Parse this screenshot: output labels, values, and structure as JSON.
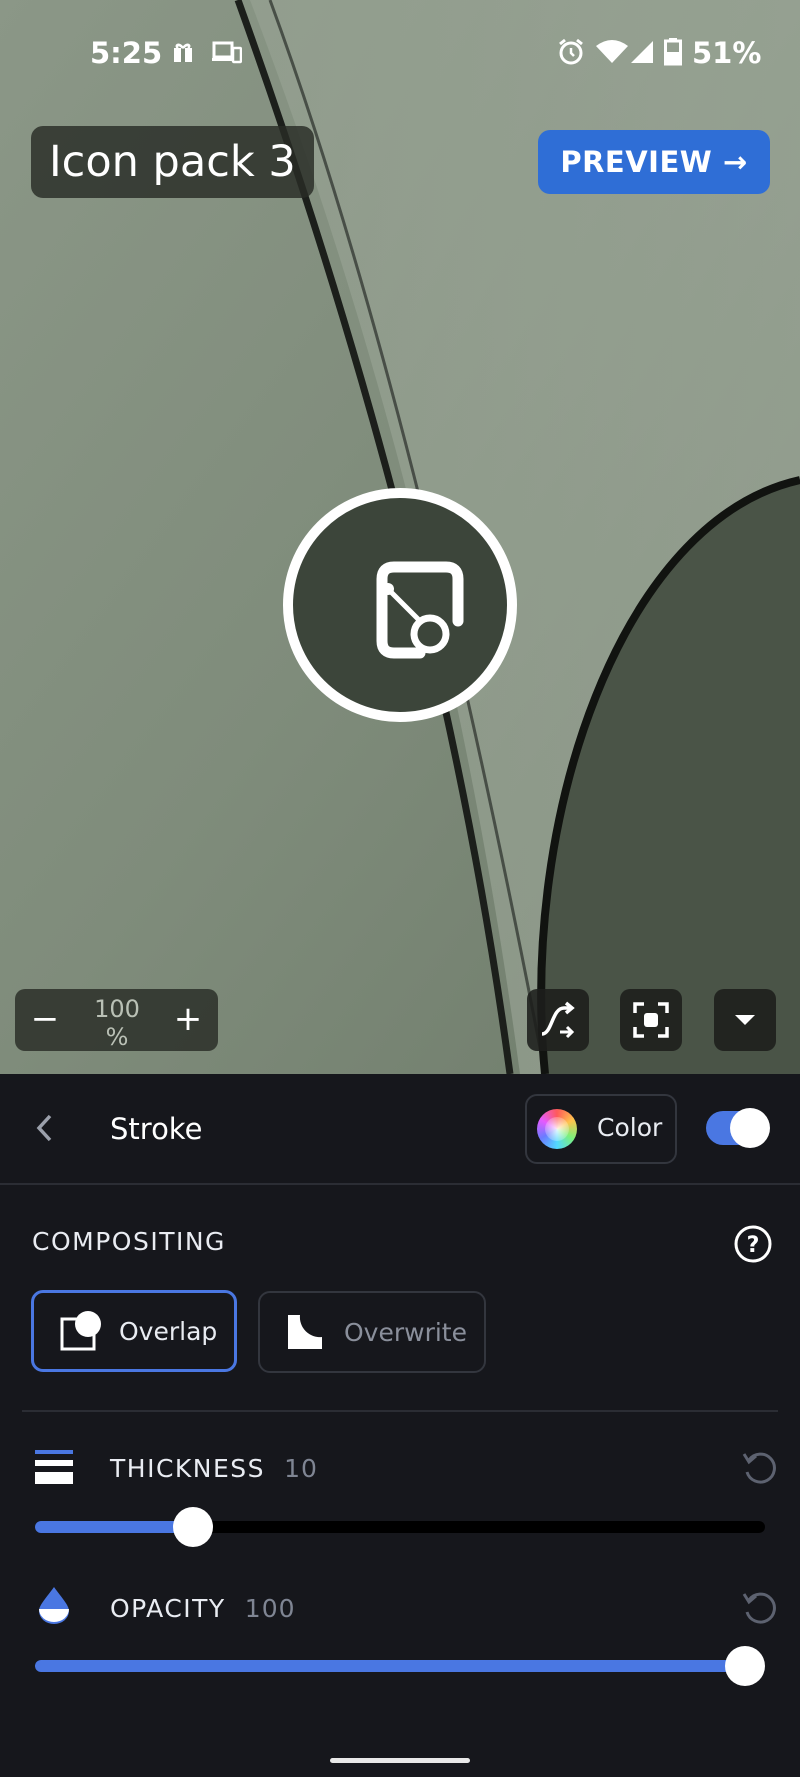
{
  "status": {
    "time": "5:25",
    "battery": "51%"
  },
  "editor": {
    "title": "Icon pack 3",
    "preview_label": "PREVIEW →",
    "zoom": {
      "minus": "−",
      "value": "100",
      "unit": "%",
      "plus": "+"
    }
  },
  "panel": {
    "section": "Stroke",
    "color_label": "Color",
    "stroke_enabled": true,
    "compositing": {
      "title": "COMPOSITING",
      "options": [
        {
          "label": "Overlap",
          "selected": true
        },
        {
          "label": "Overwrite",
          "selected": false
        }
      ]
    },
    "sliders": [
      {
        "label": "THICKNESS",
        "value": "10",
        "fraction": 0.2
      },
      {
        "label": "OPACITY",
        "value": "100",
        "fraction": 1.0
      }
    ]
  },
  "colors": {
    "accent": "#4a77e2",
    "preview_button": "#2f6ed6",
    "panel_bg": "#16171c"
  }
}
